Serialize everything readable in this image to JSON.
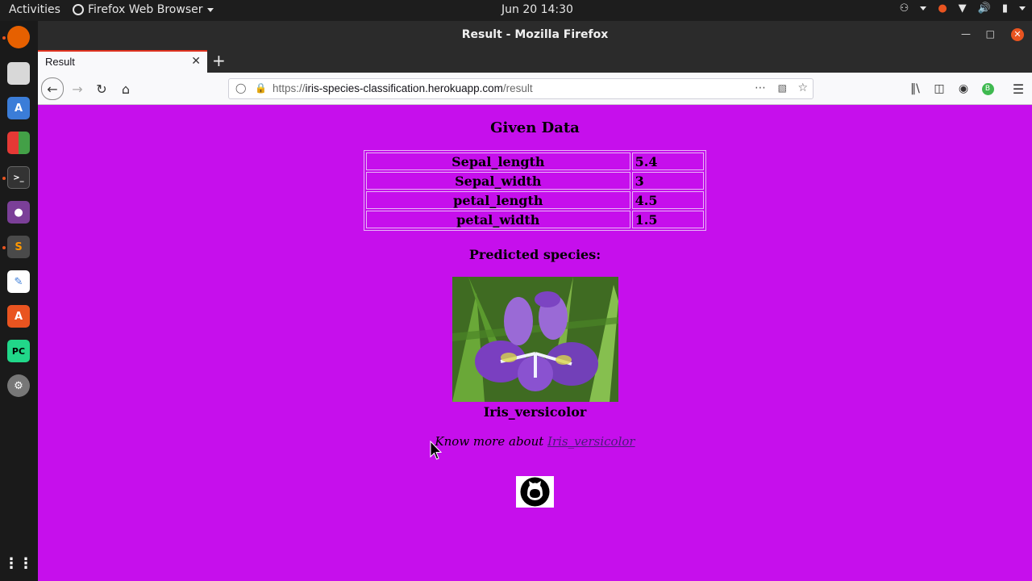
{
  "topbar": {
    "activities": "Activities",
    "app_name": "Firefox Web Browser",
    "clock": "Jun 20  14:30"
  },
  "dock": {
    "items": [
      "firefox-icon",
      "files-icon",
      "translate-icon",
      "app-grid-color-icon",
      "terminal-icon",
      "video-icon",
      "sublime-text-icon",
      "text-editor-icon",
      "software-center-icon",
      "pycharm-icon",
      "settings-icon",
      "show-apps-icon"
    ]
  },
  "window": {
    "title": "Result - Mozilla Firefox"
  },
  "tabs": [
    {
      "label": "Result"
    }
  ],
  "navbar": {
    "url_prefix": "https://",
    "url_host": "iris-species-classification.herokuapp.com",
    "url_path": "/result",
    "extension_badge": "B"
  },
  "page": {
    "heading": "Given Data",
    "table": [
      {
        "key": "Sepal_length",
        "value": "5.4"
      },
      {
        "key": "Sepal_width",
        "value": "3"
      },
      {
        "key": "petal_length",
        "value": "4.5"
      },
      {
        "key": "petal_width",
        "value": "1.5"
      }
    ],
    "predicted_label": "Predicted species:",
    "species": "Iris_versicolor",
    "know_more_text": "Know more about ",
    "know_more_link": "Iris_versicolor"
  },
  "colors": {
    "page_background": "#c60fec",
    "accent": "#e95420"
  }
}
